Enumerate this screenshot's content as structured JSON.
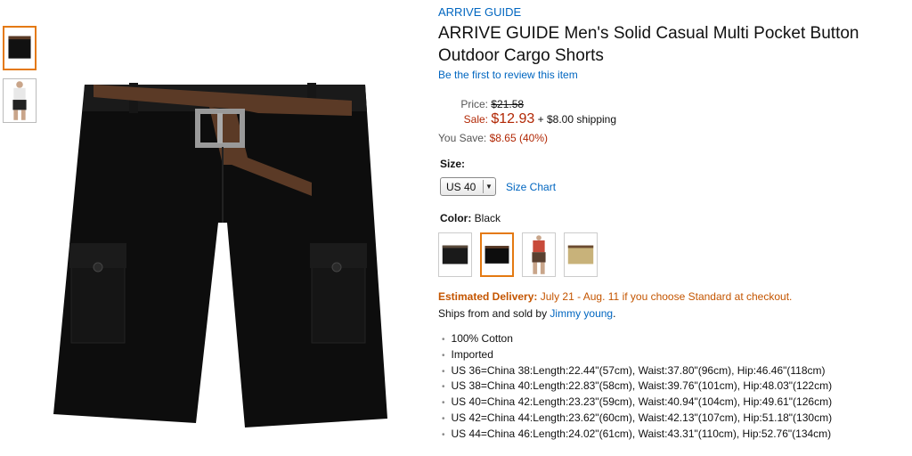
{
  "brand": "ARRIVE GUIDE",
  "title": "ARRIVE GUIDE Men's Solid Casual Multi Pocket Button Outdoor Cargo Shorts",
  "review_link": "Be the first to review this item",
  "price": {
    "price_label": "Price:",
    "list_price": "$21.58",
    "sale_label": "Sale:",
    "sale_price": "$12.93",
    "shipping": "+ $8.00 shipping",
    "save_label": "You Save:",
    "save_value": "$8.65 (40%)"
  },
  "size": {
    "label": "Size:",
    "selected": "US 40",
    "chart_link": "Size Chart"
  },
  "color": {
    "label": "Color:",
    "selected": "Black",
    "swatches": [
      "black-shorts",
      "black-shorts-selected",
      "brown-shorts-model",
      "khaki-shorts"
    ]
  },
  "delivery": {
    "label": "Estimated Delivery:",
    "text": "July 21 - Aug. 11 if you choose Standard at checkout."
  },
  "ships": {
    "prefix": "Ships from and sold by",
    "seller": "Jimmy young",
    "suffix": "."
  },
  "bullets": [
    "100% Cotton",
    "Imported",
    "US 36=China 38:Length:22.44\"(57cm), Waist:37.80\"(96cm), Hip:46.46\"(118cm)",
    "US 38=China 40:Length:22.83\"(58cm), Waist:39.76\"(101cm), Hip:48.03\"(122cm)",
    "US 40=China 42:Length:23.23\"(59cm), Waist:40.94\"(104cm), Hip:49.61\"(126cm)",
    "US 42=China 44:Length:23.62\"(60cm), Waist:42.13\"(107cm), Hip:51.18\"(130cm)",
    "US 44=China 46:Length:24.02\"(61cm), Waist:43.31\"(110cm), Hip:52.76\"(134cm)"
  ],
  "colors": {
    "link": "#0066c0",
    "sale": "#b12704",
    "delivery": "#c45500",
    "selected_border": "#e47911"
  }
}
